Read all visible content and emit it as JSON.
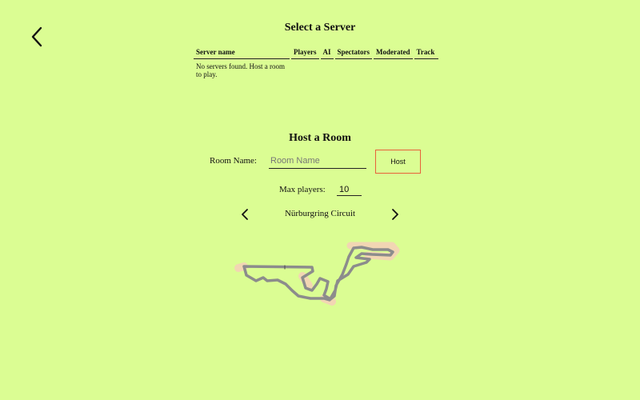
{
  "header": {
    "back_icon": "chevron-left-icon",
    "title": "Select a Server"
  },
  "servers_table": {
    "columns": [
      "Server name",
      "Players",
      "AI",
      "Spectators",
      "Moderated",
      "Track"
    ],
    "empty_message_line1": "No servers found. Host a room",
    "empty_message_line2": "to play."
  },
  "host_room": {
    "title": "Host a Room",
    "room_name_label": "Room Name:",
    "room_name_placeholder": "Room Name",
    "host_button_label": "Host",
    "max_players_label": "Max players:",
    "max_players_value": "10",
    "track_name": "Nürburgring Circuit",
    "prev_icon": "chevron-left-icon",
    "next_icon": "chevron-right-icon"
  },
  "colors": {
    "background": "#dbfd93",
    "host_button_border": "#e8623a",
    "track_asphalt": "#8c8c8c",
    "track_runoff": "#f2d6b3"
  }
}
